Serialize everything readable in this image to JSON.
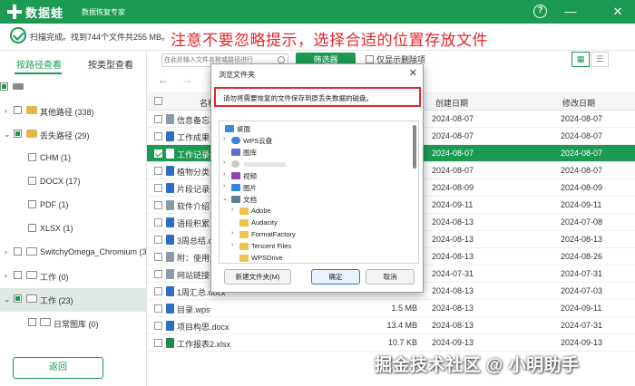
{
  "app": {
    "name": "数据蛙",
    "subtitle": "数据恢复专家",
    "help": "?",
    "minimize": "—",
    "close": "✕"
  },
  "status": {
    "scan_summary": "扫描完成。找到744个文件共255 MB。",
    "notice": "注意不要忽略提示，选择合适的位置存放文件"
  },
  "left": {
    "tab_path": "按路径查看",
    "tab_type": "按类型查看",
    "tree": [
      {
        "label": "其他路径 (338)"
      },
      {
        "label": "丢失路径 (29)"
      },
      {
        "label": "CHM (1)"
      },
      {
        "label": "DOCX (17)"
      },
      {
        "label": "PDF (1)"
      },
      {
        "label": "XLSX (1)"
      },
      {
        "label": "SwitchyOmega_Chromium (3"
      },
      {
        "label": "工作 (0)"
      },
      {
        "label": "工作 (23)"
      },
      {
        "label": "日常图库 (0)"
      }
    ],
    "back_label": "返回"
  },
  "toolbar": {
    "search_placeholder": "在此处输入文件名称或路径进行",
    "filter_label": "筛选器",
    "only_deleted": "仅显示删除项"
  },
  "table": {
    "headers": {
      "name": "名称",
      "created": "创建日期",
      "modified": "修改日期"
    },
    "rows": [
      {
        "name": "信息备忘.t",
        "size": "",
        "created": "2024-08-07",
        "modified": "2024-08-07"
      },
      {
        "name": "工作成果分",
        "size": "",
        "created": "2024-08-07",
        "modified": "2024-08-07"
      },
      {
        "name": "工作记录表",
        "size": "",
        "created": "2024-08-07",
        "modified": "2024-08-07"
      },
      {
        "name": "植物分类.",
        "size": "",
        "created": "2024-08-07",
        "modified": "2024-08-07"
      },
      {
        "name": "片段记录.",
        "size": "",
        "created": "2024-08-09",
        "modified": "2024-08-09"
      },
      {
        "name": "软件介绍 -",
        "size": "",
        "created": "2024-09-11",
        "modified": "2024-09-11"
      },
      {
        "name": "语段积累.",
        "size": "",
        "created": "2024-08-13",
        "modified": "2024-07-08"
      },
      {
        "name": "3周总结.docx",
        "size": "",
        "created": "2024-08-13",
        "modified": "2024-08-13"
      },
      {
        "name": "附：使用注",
        "size": "",
        "created": "2024-08-13",
        "modified": "2024-08-26"
      },
      {
        "name": "网站链接",
        "size": "",
        "created": "2024-07-31",
        "modified": "2024-07-31"
      },
      {
        "name": "1周汇总.docx",
        "size": "",
        "created": "2024-08-13",
        "modified": "2024-07-03"
      },
      {
        "name": "目录.wps",
        "size": "1.5 MB",
        "created": "2024-08-13",
        "modified": "2024-09-11"
      },
      {
        "name": "项目构思.docx",
        "size": "13.4 MB",
        "created": "2024-08-13",
        "modified": "2024-07-31"
      },
      {
        "name": "工作报表2.xlsx",
        "size": "10.7 KB",
        "created": "2024-09-13",
        "modified": "2024-09-13"
      }
    ]
  },
  "dialog": {
    "title": "浏览文件夹",
    "close": "✕",
    "message": "请勿将需要恢复的文件保存到原丢失数据的磁盘。",
    "tree": [
      {
        "label": "桌面",
        "arrow": "",
        "icon": "desktop"
      },
      {
        "label": "WPS云盘",
        "arrow": "›",
        "icon": "cloud"
      },
      {
        "label": "图库",
        "arrow": "",
        "icon": "gallery"
      },
      {
        "label": "",
        "arrow": "›",
        "icon": "user"
      },
      {
        "label": "视频",
        "arrow": "›",
        "icon": "video"
      },
      {
        "label": "图片",
        "arrow": "›",
        "icon": "picture"
      },
      {
        "label": "文档",
        "arrow": "⌄",
        "icon": "docs"
      },
      {
        "label": "Adobe",
        "arrow": "›",
        "icon": "folder"
      },
      {
        "label": "Audacity",
        "arrow": "",
        "icon": "folder"
      },
      {
        "label": "FormatFactory",
        "arrow": "›",
        "icon": "folder"
      },
      {
        "label": "Tencent Files",
        "arrow": "›",
        "icon": "folder"
      },
      {
        "label": "WPSDrive",
        "arrow": "",
        "icon": "folder"
      }
    ],
    "new_folder": "新建文件夹(M)",
    "ok": "确定",
    "cancel": "取消"
  },
  "watermark": "掘金技术社区 @ 小明助手",
  "colors": {
    "brand": "#1b9a52",
    "alert": "#e3262c"
  }
}
